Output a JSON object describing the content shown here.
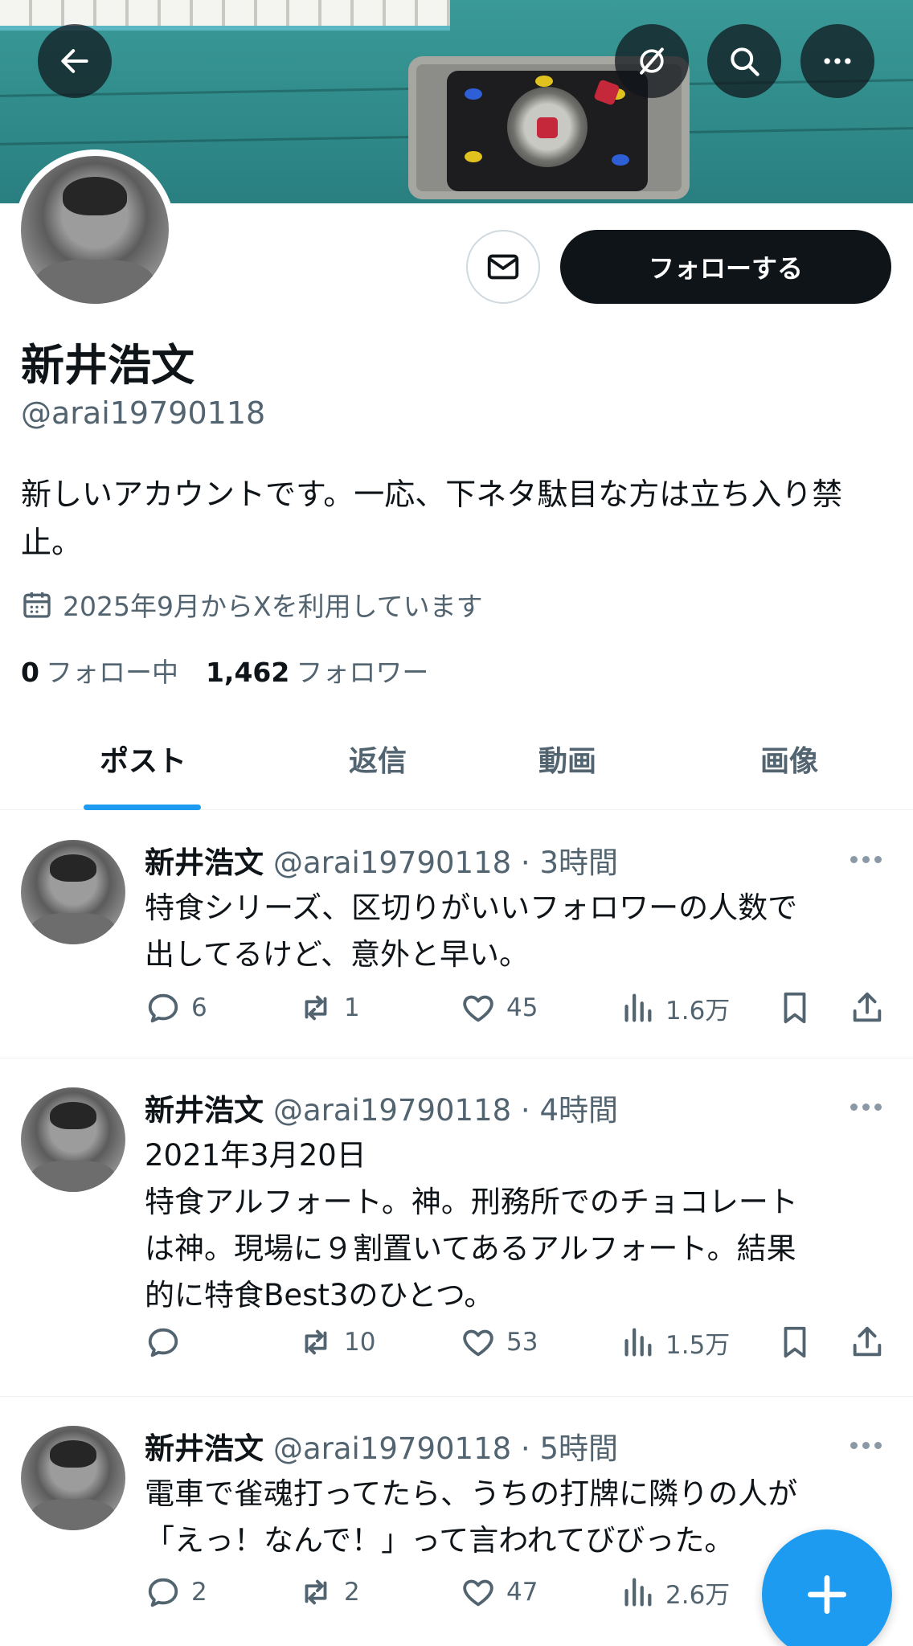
{
  "profile": {
    "name": "新井浩文",
    "handle": "@arai19790118",
    "bio": "新しいアカウントです。一応、下ネタ駄目な方は立ち入り禁止。",
    "joined": "2025年9月からXを利用しています",
    "following_count": "0",
    "following_label": "フォロー中",
    "followers_count": "1,462",
    "followers_label": "フォロワー",
    "follow_button": "フォローする"
  },
  "tabs": [
    {
      "label": "ポスト",
      "active": true
    },
    {
      "label": "返信",
      "active": false
    },
    {
      "label": "動画",
      "active": false
    },
    {
      "label": "画像",
      "active": false
    }
  ],
  "posts": [
    {
      "name": "新井浩文",
      "handle": "@arai19790118",
      "time": "3時間",
      "text": "特食シリーズ、区切りがいいフォロワーの人数で\n出してるけど、意外と早い。",
      "replies": "6",
      "reposts": "1",
      "likes": "45",
      "views": "1.6万"
    },
    {
      "name": "新井浩文",
      "handle": "@arai19790118",
      "time": "4時間",
      "text": "2021年3月20日\n特食アルフォート。神。刑務所でのチョコレート\nは神。現場に９割置いてあるアルフォート。結果\n的に特食Best3のひとつ。",
      "replies": "",
      "reposts": "10",
      "likes": "53",
      "views": "1.5万"
    },
    {
      "name": "新井浩文",
      "handle": "@arai19790118",
      "time": "5時間",
      "text": "電車で雀魂打ってたら、うちの打牌に隣りの人が\n「えっ！なんで！」って言われてびびった。",
      "replies": "2",
      "reposts": "2",
      "likes": "47",
      "views": "2.6万"
    }
  ],
  "icons": {
    "back": "arrow-left-icon",
    "grok": "grok-icon",
    "search": "search-icon",
    "more": "more-icon",
    "message": "envelope-icon",
    "calendar": "calendar-icon",
    "compose": "plus-icon"
  },
  "colors": {
    "accent": "#1d9bf0",
    "text": "#0f1419",
    "secondary": "#536471"
  }
}
